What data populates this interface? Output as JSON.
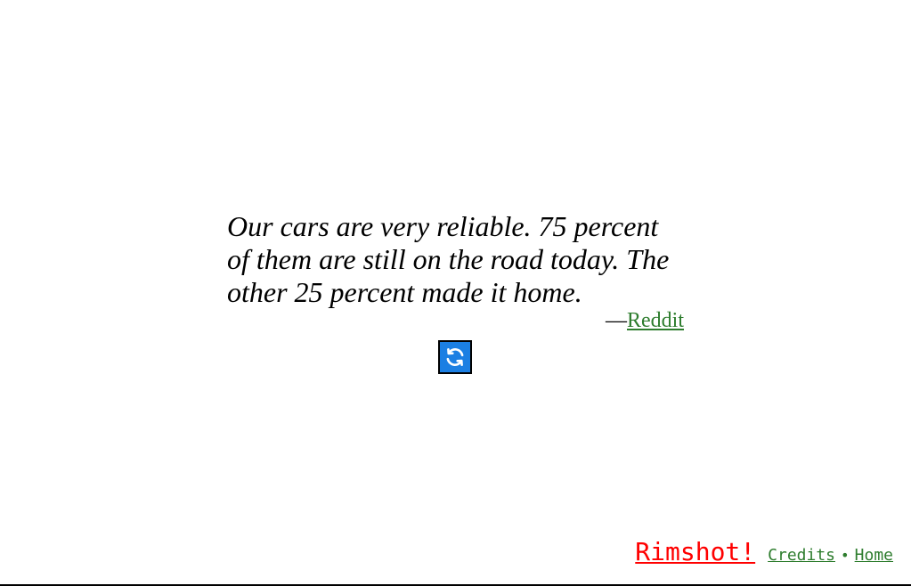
{
  "quote": {
    "text": "Our cars are very reliable. 75 percent of them are still on the road today. The other 25 percent made it home.",
    "dash": "—",
    "source": "Reddit"
  },
  "refresh_button": {
    "icon": "refresh-icon",
    "color": "#1b7fe3"
  },
  "footer": {
    "rimshot_label": "Rimshot!",
    "credits_label": "Credits",
    "separator": "•",
    "home_label": "Home"
  },
  "colors": {
    "link": "#2e7d2e",
    "rimshot": "#ff0000"
  }
}
